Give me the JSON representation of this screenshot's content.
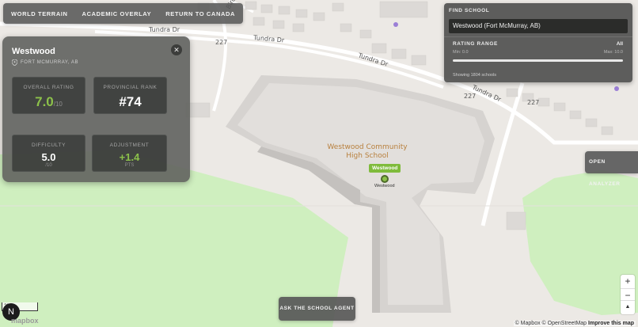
{
  "nav": {
    "items": [
      "WORLD TERRAIN",
      "ACADEMIC OVERLAY",
      "RETURN TO CANADA"
    ]
  },
  "map": {
    "streets": [
      "Bird Dr",
      "Tundra Dr",
      "Tundra Dr",
      "Tundra Dr"
    ],
    "road_numbers": [
      "227",
      "227"
    ],
    "poi": {
      "line1": "Westwood Community",
      "line2": "High School"
    },
    "marker_label": "Westwood",
    "marker_name": "Westwood",
    "colors": {
      "park": "#cfefbf",
      "building": "#d9d6d3",
      "road": "#ffffff",
      "land": "#ece9e5",
      "accent": "#7fbb3b"
    }
  },
  "school_card": {
    "name": "Westwood",
    "location": "FORT MCMURRAY, AB",
    "location_icon": "pin-icon",
    "close_icon": "close-icon",
    "overall_rating": {
      "label": "OVERALL RATING",
      "value": "7.0",
      "unit": "/10"
    },
    "provincial_rank": {
      "label": "PROVINCIAL RANK",
      "value": "#74"
    },
    "difficulty": {
      "label": "DIFFICULTY",
      "value": "5.0",
      "unit": "/10"
    },
    "adjustment": {
      "label": "ADJUSTMENT",
      "value": "+1.4",
      "unit": "PTS"
    }
  },
  "finder": {
    "heading": "FIND SCHOOL",
    "input_value": "Westwood (Fort McMurray, AB)",
    "range_label": "RATING RANGE",
    "range_value": "All",
    "min_label": "Min: 0.0",
    "max_label": "Max: 10.0",
    "range": [
      0,
      10
    ],
    "showing": "Showing 1804 schools"
  },
  "analyzer_button": "OPEN ANALYZER",
  "agent_button": "ASK THE SCHOOL AGENT",
  "zoom": {
    "in": "+",
    "out": "−",
    "compass": "▲"
  },
  "attribution": {
    "mapbox": "© Mapbox",
    "osm": "© OpenStreetMap",
    "improve": "Improve this map"
  },
  "logo": {
    "n": "N",
    "mapbox": "mapbox"
  },
  "scale": "20"
}
